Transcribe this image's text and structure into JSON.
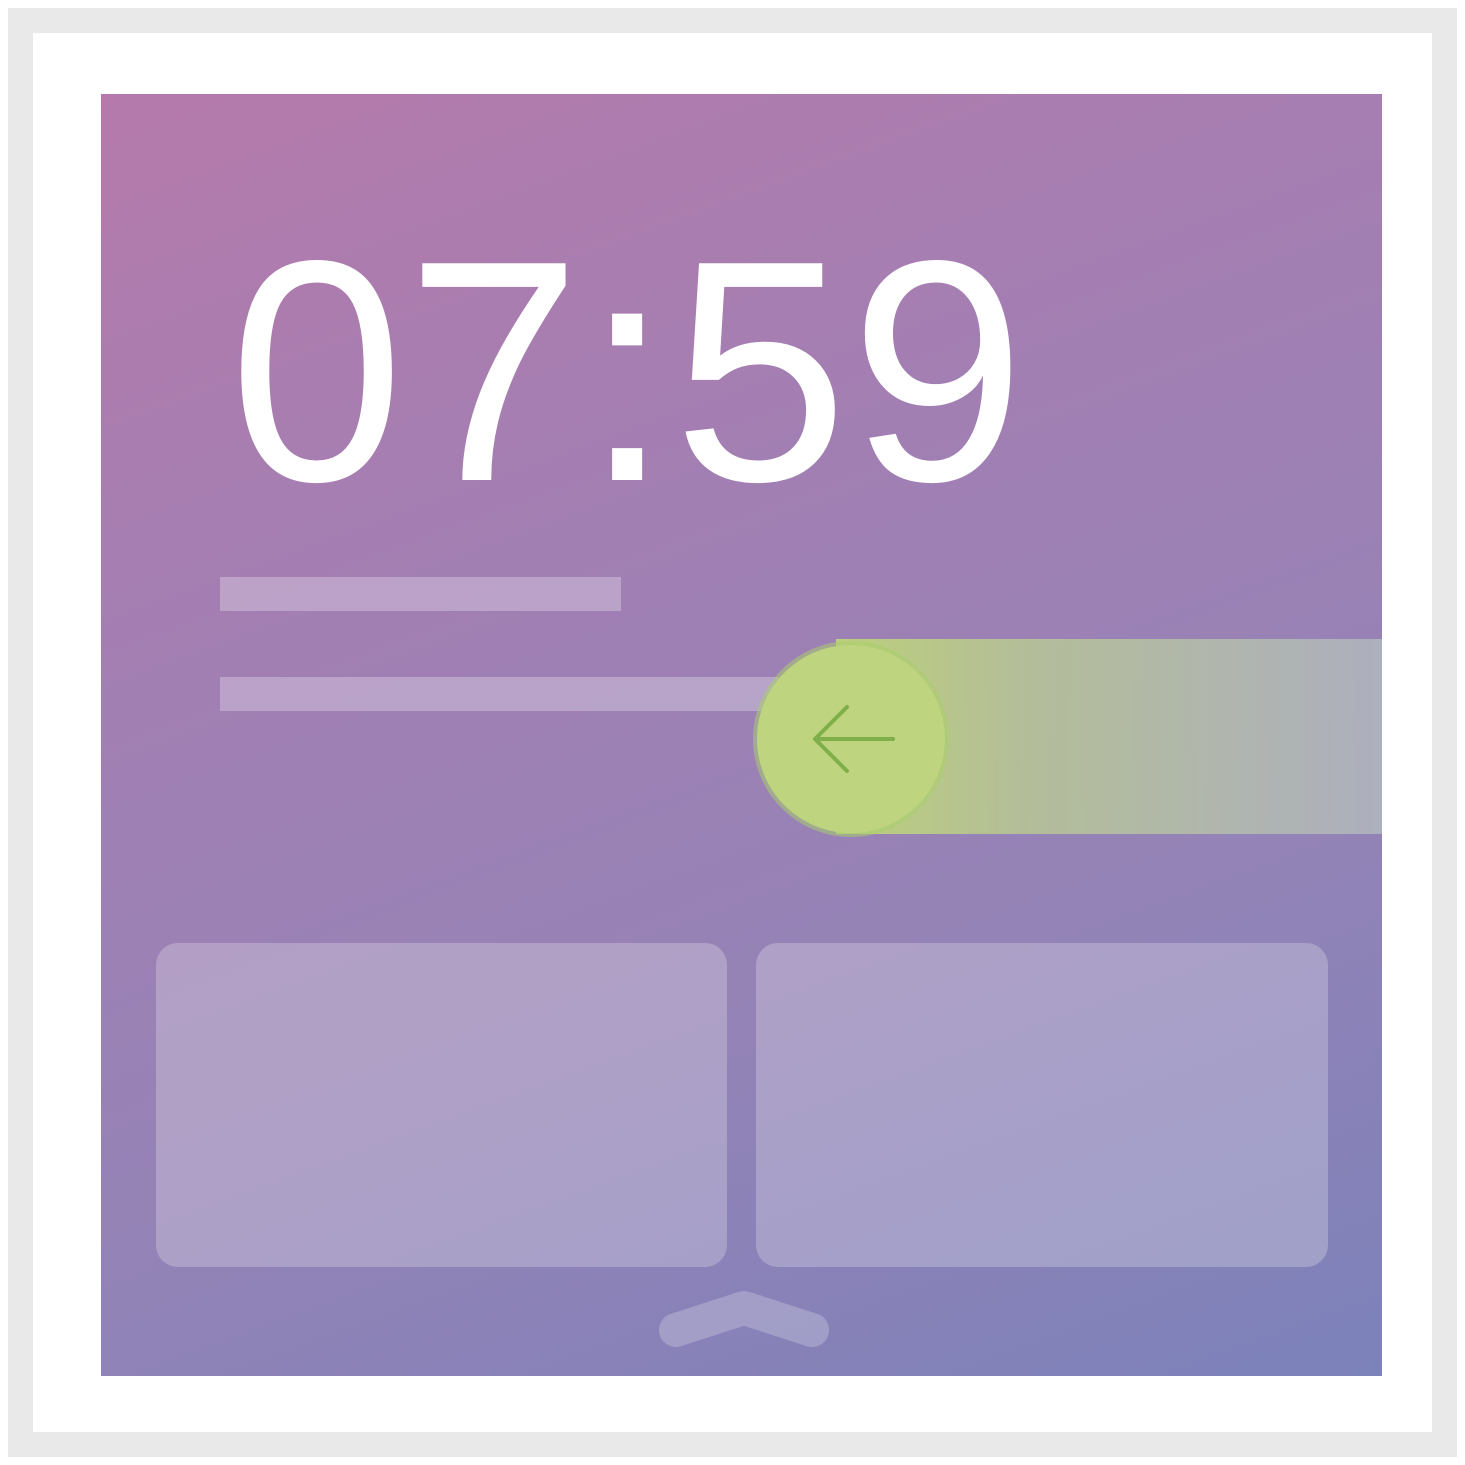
{
  "lock_screen": {
    "time": "07:59"
  },
  "colors": {
    "frame": "#e9e9e9",
    "screen_gradient_start": "#b57aab",
    "screen_gradient_end": "#7c82ba",
    "swipe_knob": "#bed47e",
    "arrow": "#7fae4b",
    "placeholder": "rgba(255,255,255,0.28)"
  },
  "icons": {
    "swipe_arrow": "arrow-left-icon",
    "expand_handle": "chevron-up-icon"
  }
}
